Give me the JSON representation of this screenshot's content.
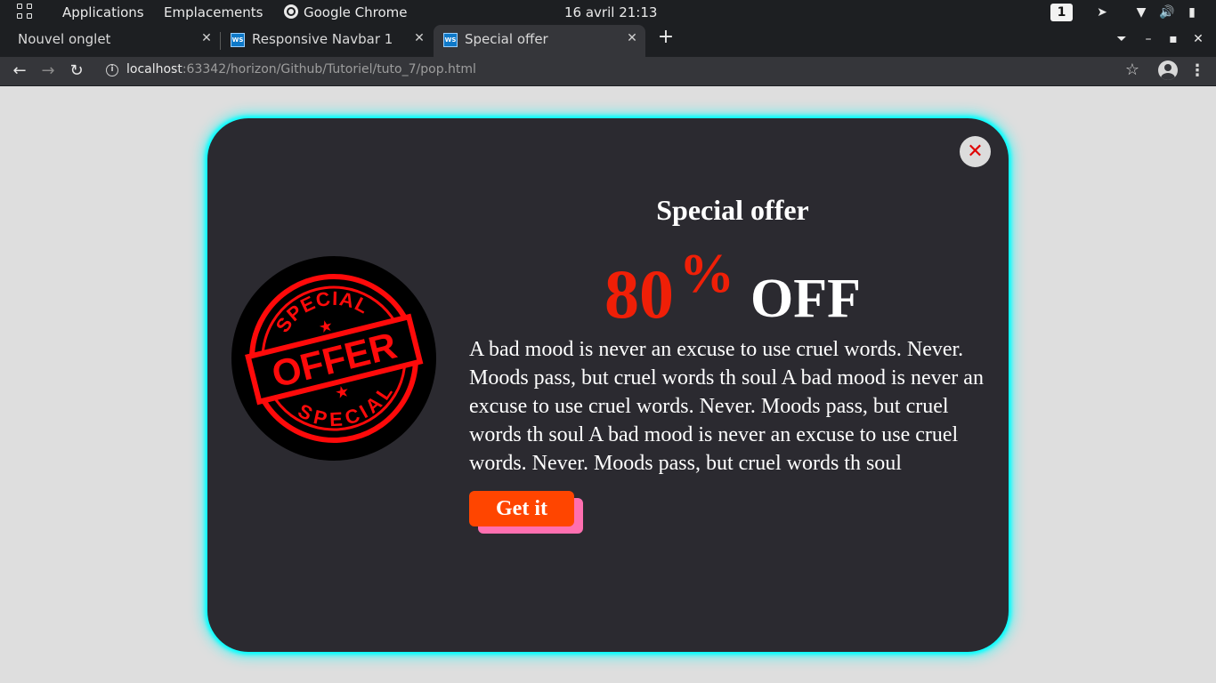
{
  "topbar": {
    "applications": "Applications",
    "places": "Emplacements",
    "active_app": "Google Chrome",
    "clock": "16 avril  21:13",
    "workspace": "1"
  },
  "tabs": [
    {
      "title": "Nouvel onglet"
    },
    {
      "title": "Responsive Navbar 1",
      "favicon": "WS"
    },
    {
      "title": "Special offer",
      "favicon": "WS",
      "active": true
    }
  ],
  "toolbar": {
    "url_host": "localhost",
    "url_rest": ":63342/horizon/Github/Tutoriel/tuto_7/pop.html"
  },
  "popup": {
    "title": "Special offer",
    "discount_number": "80",
    "discount_symbol": "%",
    "discount_word": "OFF",
    "description": "A bad mood is never an excuse to use cruel words. Never. Moods pass, but cruel words th soul A bad mood is never an excuse to use cruel words. Never. Moods pass, but cruel words th soul A bad mood is never an excuse to use cruel words. Never. Moods pass, but cruel words th soul",
    "cta_label": "Get it",
    "close_glyph": "✕",
    "badge": {
      "top_text": "SPECIAL",
      "center_text": "OFFER",
      "bottom_text": "SPECIAL"
    }
  },
  "colors": {
    "accent_red": "#ef1f07",
    "cta_orange": "#ff4500",
    "cta_shadow_pink": "#ff6fb0",
    "glow_cyan": "#00ffff",
    "popup_bg": "#2b2a30",
    "page_bg": "#dedede"
  }
}
